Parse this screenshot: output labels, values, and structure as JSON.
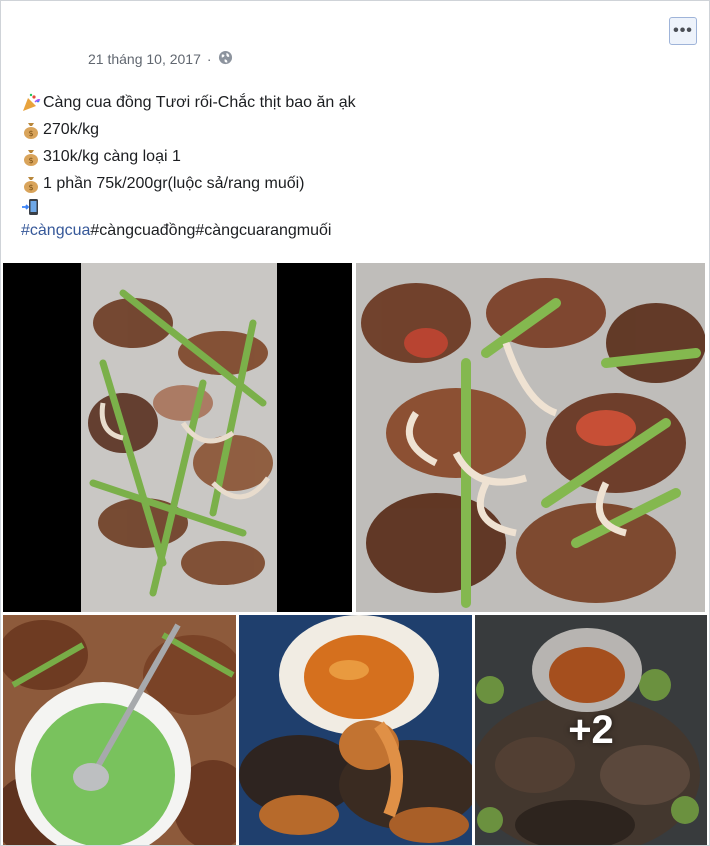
{
  "post": {
    "date": "21 tháng 10, 2017",
    "separator": "·",
    "privacy_icon": "globe-icon",
    "more_label": "•••",
    "lines": [
      {
        "icon": "party-popper-icon",
        "text": "Càng cua đồng Tươi rối-Chắc thịt bao ăn ạk"
      },
      {
        "icon": "money-bag-icon",
        "text": "270k/kg"
      },
      {
        "icon": "money-bag-icon",
        "text": "310k/kg càng loại 1"
      },
      {
        "icon": "money-bag-icon",
        "text": "1 phần 75k/200gr(luộc sả/rang muối)"
      },
      {
        "icon": "mobile-phone-icon",
        "text": ""
      }
    ],
    "hashtags": [
      "#càngcua",
      "#càngcuađồng",
      "#càngcuarangmuối"
    ]
  },
  "photos": {
    "top": [
      {
        "alt": "crab claws with lemongrass in basket"
      },
      {
        "alt": "close-up of crab claws and lemongrass"
      }
    ],
    "bottom": [
      {
        "alt": "crab claws with green salt dip"
      },
      {
        "alt": "crab claws with chili sauce"
      },
      {
        "alt": "crab claws with sauce and limes",
        "more_count": "+2"
      }
    ]
  },
  "colors": {
    "link": "#365899",
    "meta": "#616770",
    "border": "#cfd3d8"
  }
}
